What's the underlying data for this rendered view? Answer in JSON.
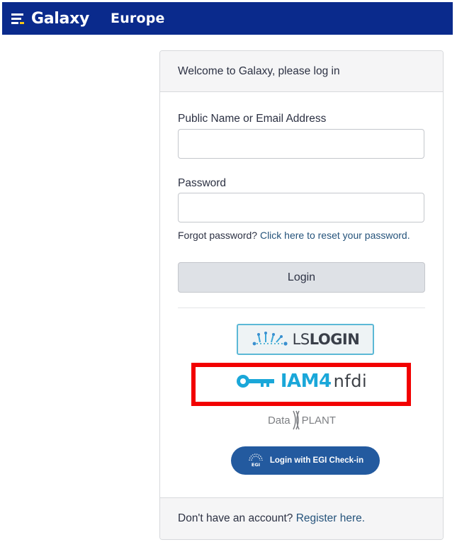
{
  "navbar": {
    "brand_name": "Galaxy",
    "brand_sub": "Europe",
    "brand_icon": "galaxy-logo-icon",
    "background": "#0a2a8c"
  },
  "login": {
    "header": "Welcome to Galaxy, please log in",
    "email_label": "Public Name or Email Address",
    "email_value": "",
    "password_label": "Password",
    "password_value": "",
    "forgot_text": "Forgot password?",
    "forgot_link": "Click here to reset your password.",
    "login_button": "Login"
  },
  "identity_providers": [
    {
      "id": "lslogin",
      "prefix": "LS",
      "suffix": "LOGIN",
      "icon": "lifescience-login-icon",
      "accent": "#5bb8d6"
    },
    {
      "id": "iam4nfdi",
      "main": "IAM4",
      "sub": "nfdi",
      "icon": "key-icon",
      "accent": "#1aa7d9",
      "highlighted": true
    },
    {
      "id": "dataplant",
      "left": "Data",
      "right": "PLANT",
      "icon": "dataplant-logo-icon"
    },
    {
      "id": "egi",
      "label": "Login with EGI Check-in",
      "icon": "egi-logo-icon",
      "accent": "#235a9f"
    }
  ],
  "footer": {
    "text": "Don't have an account?",
    "link": "Register here."
  },
  "colors": {
    "link": "#25537b",
    "highlight": "#f20000"
  }
}
